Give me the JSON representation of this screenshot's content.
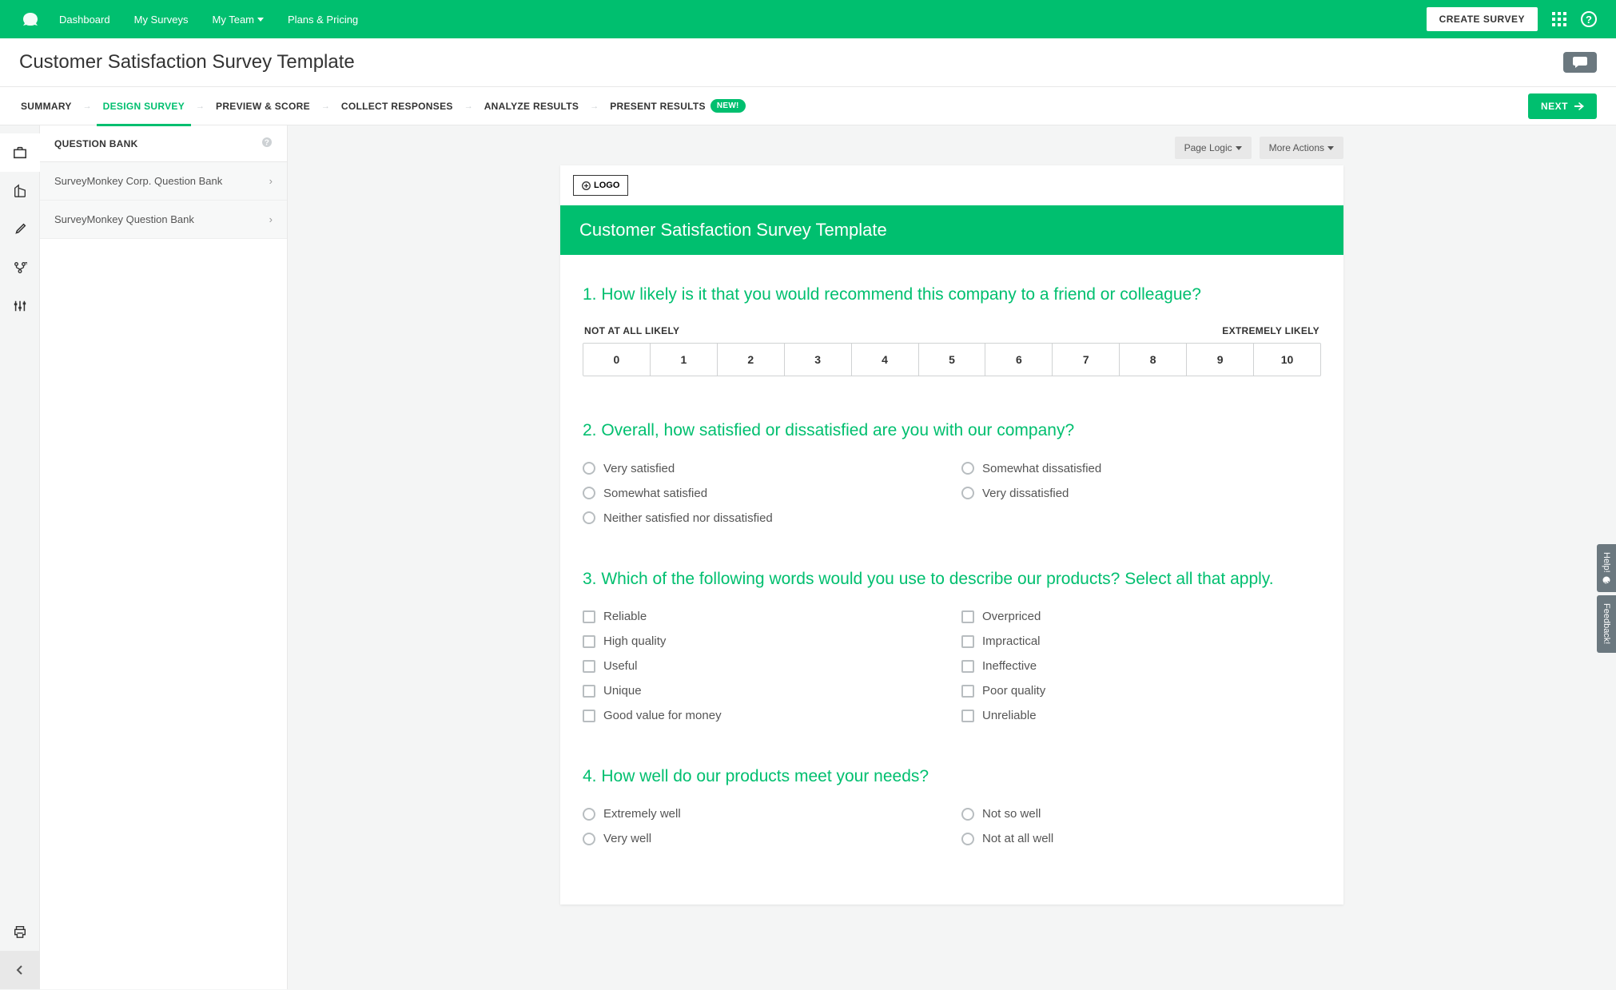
{
  "nav": {
    "links": [
      "Dashboard",
      "My Surveys",
      "My Team",
      "Plans & Pricing"
    ],
    "create": "CREATE SURVEY"
  },
  "page": {
    "title": "Customer Satisfaction Survey Template"
  },
  "steps": {
    "items": [
      "SUMMARY",
      "DESIGN SURVEY",
      "PREVIEW & SCORE",
      "COLLECT RESPONSES",
      "ANALYZE RESULTS",
      "PRESENT RESULTS"
    ],
    "badge": "NEW!",
    "next": "NEXT"
  },
  "panel": {
    "header": "QUESTION BANK",
    "rows": [
      "SurveyMonkey Corp. Question Bank",
      "SurveyMonkey Question Bank"
    ]
  },
  "actions": {
    "page_logic": "Page Logic",
    "more": "More Actions"
  },
  "survey": {
    "logo_btn": "LOGO",
    "title": "Customer Satisfaction Survey Template",
    "questions": [
      {
        "num": "1.",
        "text": "How likely is it that you would recommend this company to a friend or colleague?",
        "type": "nps",
        "nps_left": "NOT AT ALL LIKELY",
        "nps_right": "EXTREMELY LIKELY",
        "scale": [
          "0",
          "1",
          "2",
          "3",
          "4",
          "5",
          "6",
          "7",
          "8",
          "9",
          "10"
        ]
      },
      {
        "num": "2.",
        "text": "Overall, how satisfied or dissatisfied are you with our company?",
        "type": "radio",
        "options_left": [
          "Very satisfied",
          "Somewhat satisfied",
          "Neither satisfied nor dissatisfied"
        ],
        "options_right": [
          "Somewhat dissatisfied",
          "Very dissatisfied"
        ]
      },
      {
        "num": "3.",
        "text": "Which of the following words would you use to describe our products? Select all that apply.",
        "type": "checkbox",
        "options_left": [
          "Reliable",
          "High quality",
          "Useful",
          "Unique",
          "Good value for money"
        ],
        "options_right": [
          "Overpriced",
          "Impractical",
          "Ineffective",
          "Poor quality",
          "Unreliable"
        ]
      },
      {
        "num": "4.",
        "text": "How well do our products meet your needs?",
        "type": "radio",
        "options_left": [
          "Extremely well",
          "Very well"
        ],
        "options_right": [
          "Not so well",
          "Not at all well"
        ]
      }
    ]
  },
  "side_tabs": {
    "help": "Help!",
    "feedback": "Feedback!"
  }
}
